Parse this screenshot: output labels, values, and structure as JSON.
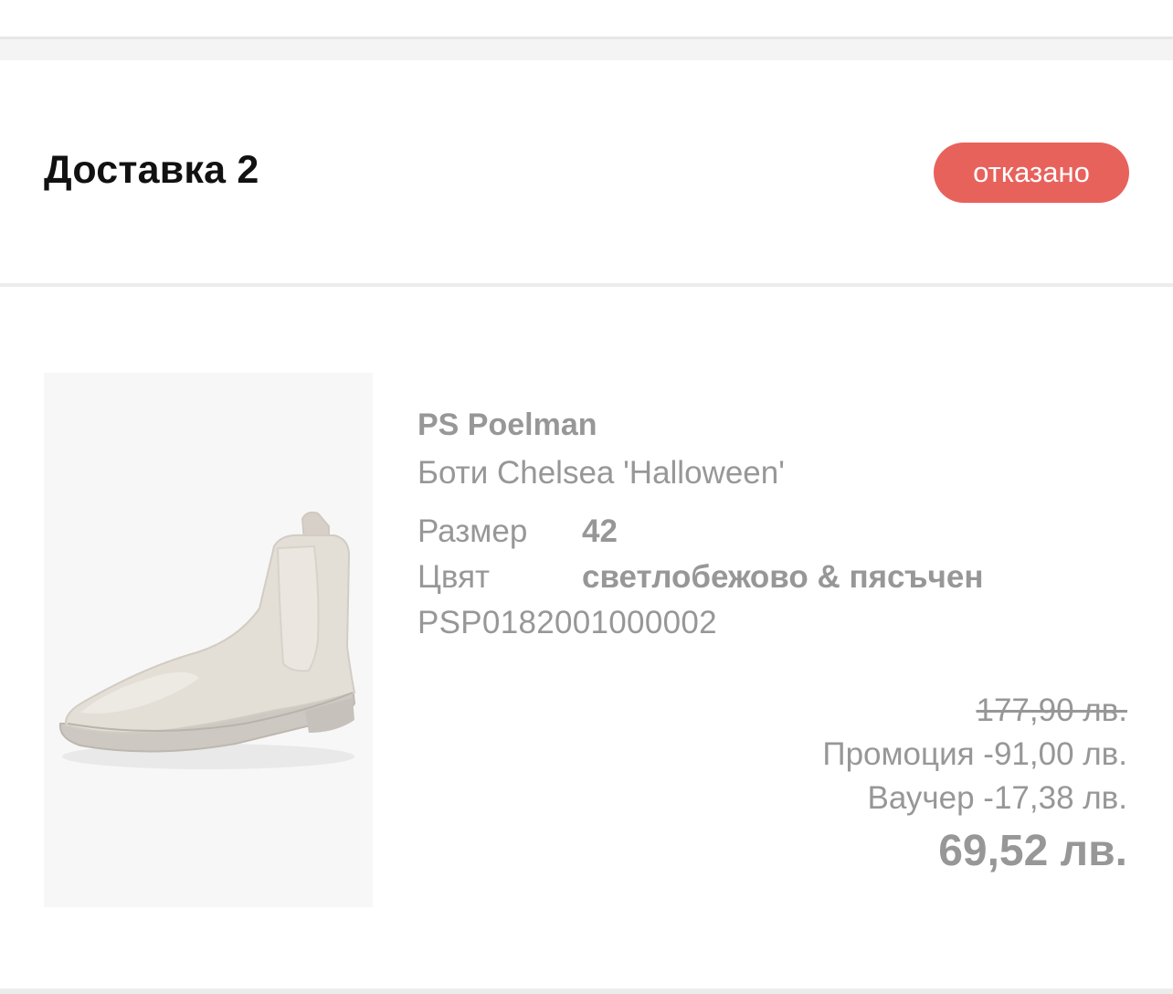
{
  "delivery": {
    "title": "Доставка 2",
    "status": "отказано",
    "status_color": "#e8625c"
  },
  "product": {
    "image_icon": "chelsea-boot",
    "brand": "PS Poelman",
    "name": "Боти Chelsea 'Halloween'",
    "size_label": "Размер",
    "size_value": "42",
    "color_label": "Цвят",
    "color_value": "светлобежово & пясъчен",
    "sku": "PSP0182001000002"
  },
  "prices": {
    "original": "177,90 лв.",
    "promotion": "Промоция -91,00 лв.",
    "voucher": "Ваучер -17,38 лв.",
    "total": "69,52 лв."
  }
}
